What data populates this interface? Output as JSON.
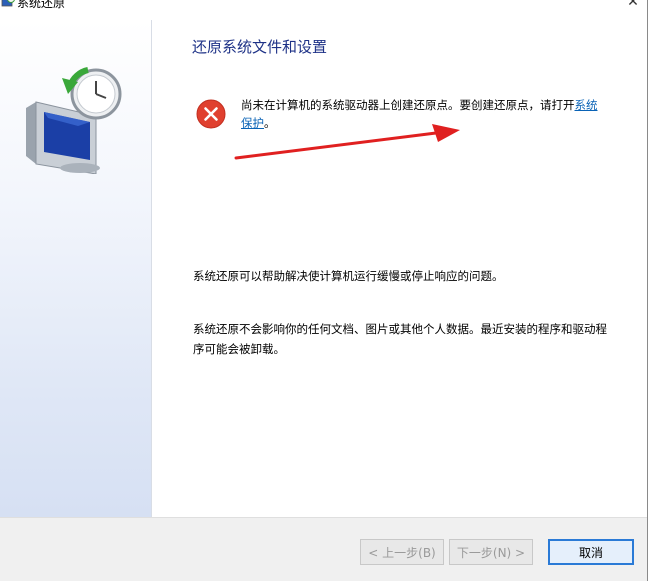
{
  "window": {
    "title": "系统还原",
    "close_glyph": "✕"
  },
  "icons": {
    "title_icon": "system-restore-icon",
    "hero_icon": "system-restore-monitor-icon",
    "error_icon": "error-icon"
  },
  "colors": {
    "heading": "#1e3287",
    "link": "#0a63b6",
    "error_red": "#e0402f",
    "arrow_red": "#e02020",
    "primary_border": "#2a7ad6"
  },
  "main": {
    "heading": "还原系统文件和设置",
    "error_text": "尚未在计算机的系统驱动器上创建还原点。要创建还原点，请打开",
    "error_link": "系统保护",
    "error_suffix": "。",
    "para1": "系统还原可以帮助解决使计算机运行缓慢或停止响应的问题。",
    "para2": "系统还原不会影响你的任何文档、图片或其他个人数据。最近安装的程序和驱动程序可能会被卸载。"
  },
  "footer": {
    "back_label": "< 上一步(B)",
    "next_label": "下一步(N) >",
    "cancel_label": "取消"
  }
}
